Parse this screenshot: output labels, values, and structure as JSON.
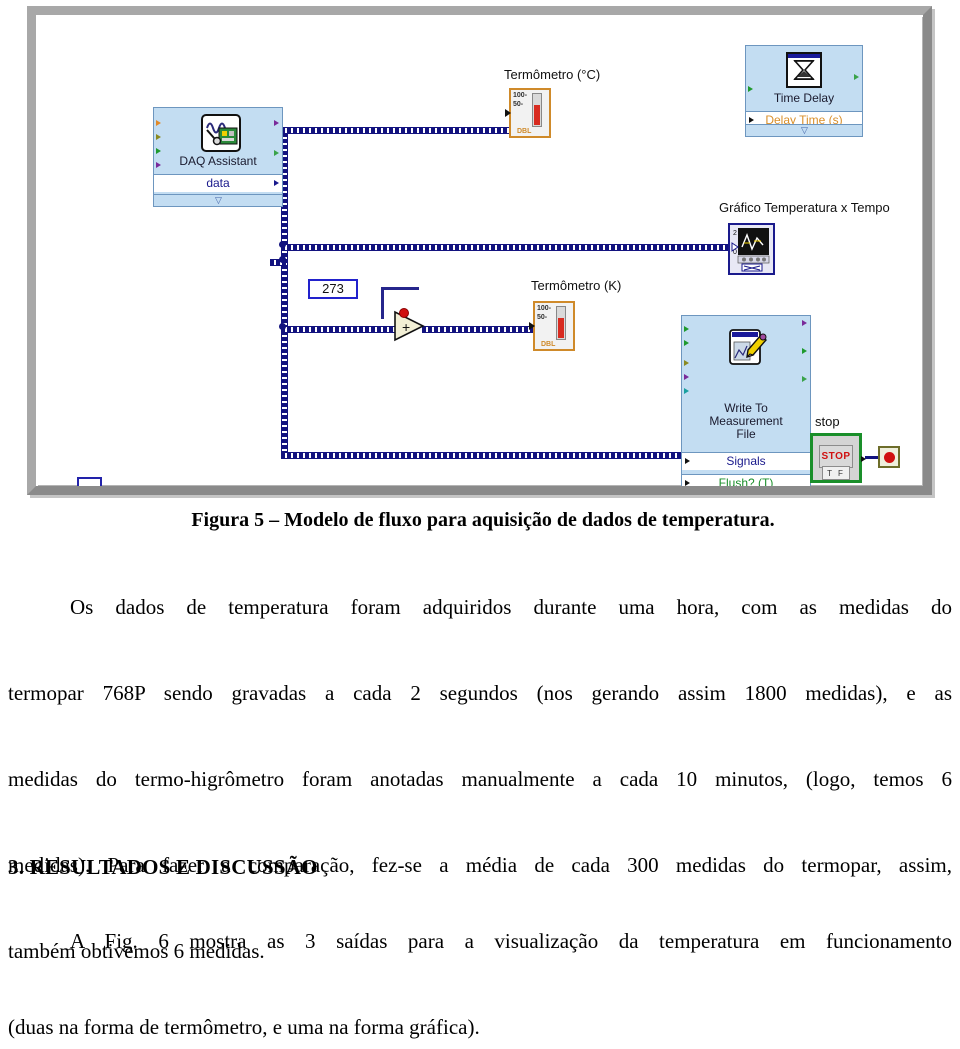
{
  "figure": {
    "name": "labview-block-diagram",
    "loop": {
      "type": "while-loop",
      "iteration_terminal": "i"
    },
    "nodes": {
      "daq": {
        "title": "DAQ Assistant",
        "output_terminal": "data",
        "icon": "daq-card-waveform-icon",
        "left_terminal_colors": [
          "#e08a2a",
          "#8a8a22",
          "#1f9a2e",
          "#7a2a9a"
        ],
        "right_terminal_colors": [
          "#7a2a9a",
          "#3aa34a"
        ]
      },
      "time_delay": {
        "title": "Time Delay",
        "input_terminal": "Delay Time (s)",
        "icon": "hourglass-icon",
        "terminal_color": "#d98f2a"
      },
      "write_file": {
        "title_lines": [
          "Write To",
          "Measurement",
          "File"
        ],
        "terminals": [
          {
            "label": "Signals",
            "color": "#1a1a8c"
          },
          {
            "label": "Flush? (T)",
            "color": "#1a8f2a"
          }
        ],
        "icon": "write-to-file-pencil-icon",
        "left_terminal_colors": [
          "#1f9a2e",
          "#1f9a2e",
          "#8a8a22",
          "#7a2a9a",
          "#1aa0a0"
        ],
        "right_terminal_colors": [
          "#7a2a9a",
          "#1f9a2e",
          "#8a8a22",
          "#3aa34a"
        ]
      },
      "thermo_c": {
        "label": "Termômetro (°C)",
        "icon": "thermometer-indicator-icon",
        "scale": [
          "100",
          "50"
        ],
        "datatype": "DBL"
      },
      "thermo_k": {
        "label": "Termômetro (K)",
        "icon": "thermometer-indicator-icon",
        "scale": [
          "100",
          "50"
        ],
        "datatype": "DBL"
      },
      "graph": {
        "label": "Gráfico Temperatura x Tempo",
        "icon": "waveform-chart-icon"
      },
      "constant": {
        "value": "273"
      },
      "add": {
        "symbol": "+",
        "name": "add-function"
      },
      "stop": {
        "label": "stop",
        "face_text": "STOP",
        "bool_text": "T F",
        "icon": "stop-button-icon"
      }
    },
    "colors": {
      "express_vi_fill": "#c3ddf2",
      "express_vi_border": "#6d96bf",
      "wire": "#13137f",
      "loop_border": "#8a8a8a",
      "indicator_border": "#cf8a2a",
      "stop_border": "#1a8f2a"
    }
  },
  "document": {
    "caption": "Figura 5 – Modelo de fluxo para aquisição de dados de temperatura.",
    "paragraph1_lines": [
      "Os dados de temperatura foram adquiridos durante uma hora, com as medidas do",
      "termopar 768P sendo gravadas a cada 2 segundos (nos gerando assim 1800 medidas), e as",
      "medidas do termo-higrômetro foram anotadas manualmente a cada 10 minutos, (logo, temos 6",
      "medidas). Para fazer a comparação, fez-se a média de cada 300 medidas do termopar, assim,",
      "também obtivemos 6 medidas."
    ],
    "section_heading": "3. RESULTADOS E DISCUSSÃO",
    "paragraph2_lines": [
      "A Fig. 6 mostra as 3 saídas para a visualização da temperatura em funcionamento",
      "(duas na forma de termômetro, e uma na forma gráfica)."
    ]
  }
}
